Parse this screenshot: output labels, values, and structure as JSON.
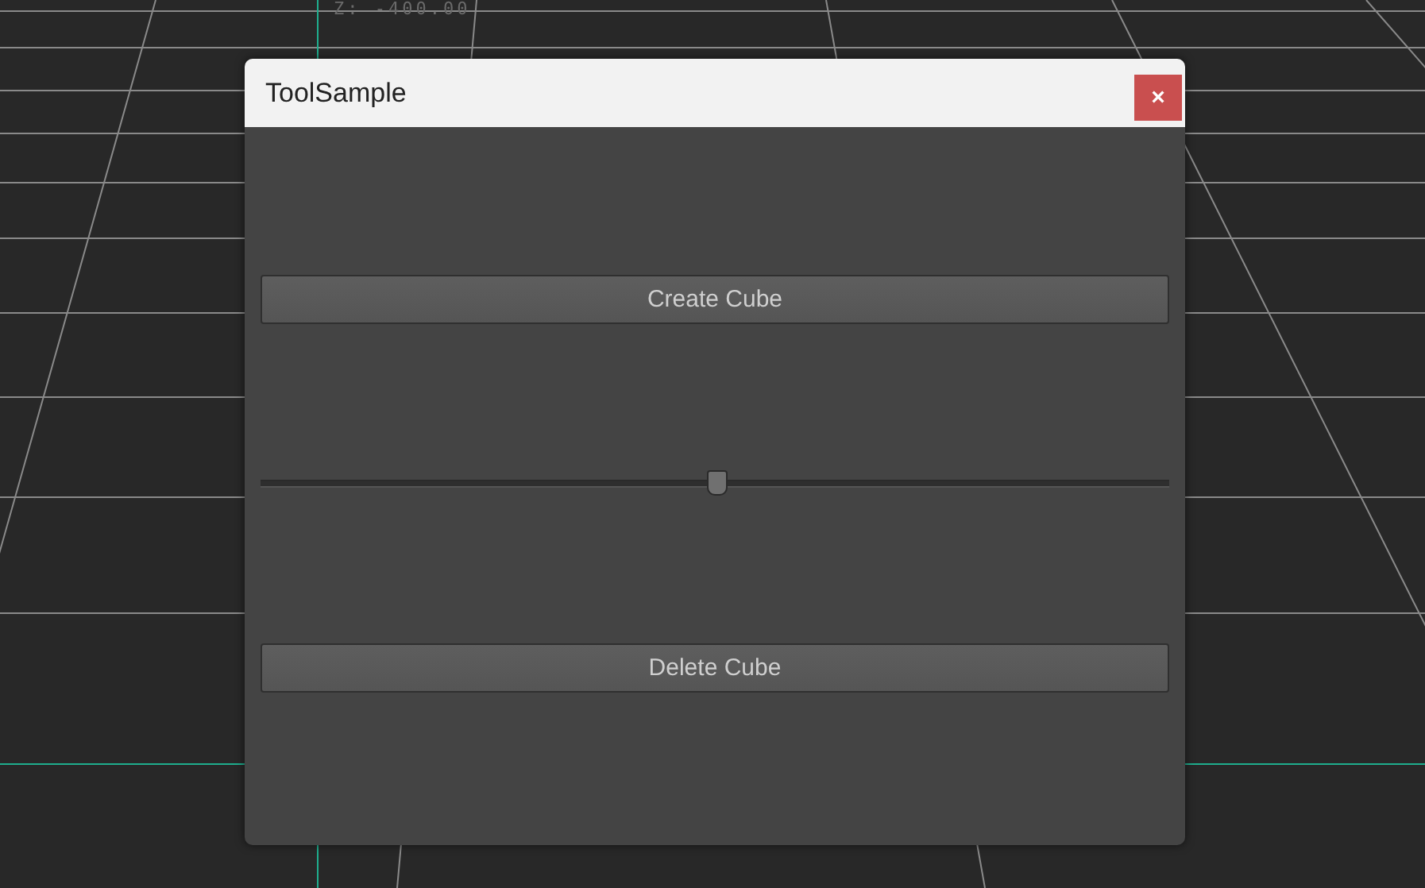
{
  "viewport": {
    "coordinate_label": "Z: -400.00"
  },
  "window": {
    "title": "ToolSample",
    "close_label": "×"
  },
  "controls": [
    {
      "kind": "button",
      "label": "Create Cube"
    },
    {
      "kind": "slider",
      "level": 0.5
    },
    {
      "kind": "button",
      "label": "Delete Cube"
    }
  ]
}
